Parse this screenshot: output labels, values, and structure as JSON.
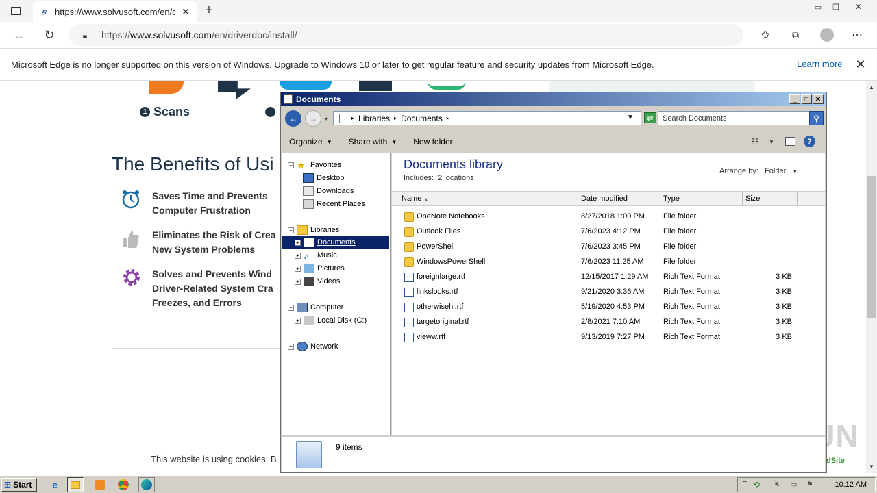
{
  "browser": {
    "tab_title": "https://www.solvusoft.com/en/d",
    "url_prefix": "https://",
    "url_host": "www.solvusoft.com",
    "url_path": "/en/driverdoc/install/",
    "info_message": "Microsoft Edge is no longer supported on this version of Windows. Upgrade to Windows 10 or later to get regular feature and security updates from Microsoft Edge.",
    "learn_more": "Learn more"
  },
  "webpage": {
    "step_number": "1",
    "step_label": "Scans",
    "benefits_heading": "The Benefits of Usi",
    "benefits": [
      {
        "line1": "Saves Time and Prevents",
        "line2": "Computer Frustration",
        "line3": ""
      },
      {
        "line1": "Eliminates the Risk of Crea",
        "line2": "New System Problems",
        "line3": ""
      },
      {
        "line1": "Solves and Prevents Wind",
        "line2": "Driver-Related System Cra",
        "line3": "Freezes, and Errors"
      }
    ],
    "cookie_text": "This website is using cookies. B",
    "badge_text": "dSite"
  },
  "explorer": {
    "title": "Documents",
    "breadcrumb": [
      "Libraries",
      "Documents"
    ],
    "search_placeholder": "Search Documents",
    "commands": {
      "organize": "Organize",
      "share_with": "Share with",
      "new_folder": "New folder"
    },
    "tree": {
      "favorites": "Favorites",
      "desktop": "Desktop",
      "downloads": "Downloads",
      "recent_places": "Recent Places",
      "libraries": "Libraries",
      "documents": "Documents",
      "music": "Music",
      "pictures": "Pictures",
      "videos": "Videos",
      "computer": "Computer",
      "local_disk": "Local Disk (C:)",
      "network": "Network"
    },
    "library_title": "Documents library",
    "includes_label": "Includes:",
    "includes_value": "2 locations",
    "arrange_label": "Arrange by:",
    "arrange_value": "Folder",
    "columns": {
      "name": "Name",
      "date": "Date modified",
      "type": "Type",
      "size": "Size"
    },
    "files": [
      {
        "name": "OneNote Notebooks",
        "date": "8/27/2018 1:00 PM",
        "type": "File folder",
        "size": "",
        "kind": "folder"
      },
      {
        "name": "Outlook Files",
        "date": "7/6/2023 4:12 PM",
        "type": "File folder",
        "size": "",
        "kind": "folder"
      },
      {
        "name": "PowerShell",
        "date": "7/6/2023 3:45 PM",
        "type": "File folder",
        "size": "",
        "kind": "folder"
      },
      {
        "name": "WindowsPowerShell",
        "date": "7/6/2023 11:25 AM",
        "type": "File folder",
        "size": "",
        "kind": "folder"
      },
      {
        "name": "foreignlarge.rtf",
        "date": "12/15/2017 1:29 AM",
        "type": "Rich Text Format",
        "size": "3 KB",
        "kind": "rtf"
      },
      {
        "name": "linkslooks.rtf",
        "date": "9/21/2020 3:36 AM",
        "type": "Rich Text Format",
        "size": "3 KB",
        "kind": "rtf"
      },
      {
        "name": "otherwisehi.rtf",
        "date": "5/19/2020 4:53 PM",
        "type": "Rich Text Format",
        "size": "3 KB",
        "kind": "rtf"
      },
      {
        "name": "targetoriginal.rtf",
        "date": "2/8/2021 7:10 AM",
        "type": "Rich Text Format",
        "size": "3 KB",
        "kind": "rtf"
      },
      {
        "name": "vieww.rtf",
        "date": "9/13/2019 7:27 PM",
        "type": "Rich Text Format",
        "size": "3 KB",
        "kind": "rtf"
      }
    ],
    "item_count": "9 items"
  },
  "taskbar": {
    "start_label": "Start",
    "clock": "10:12 AM"
  },
  "watermark": "ANY RUN"
}
